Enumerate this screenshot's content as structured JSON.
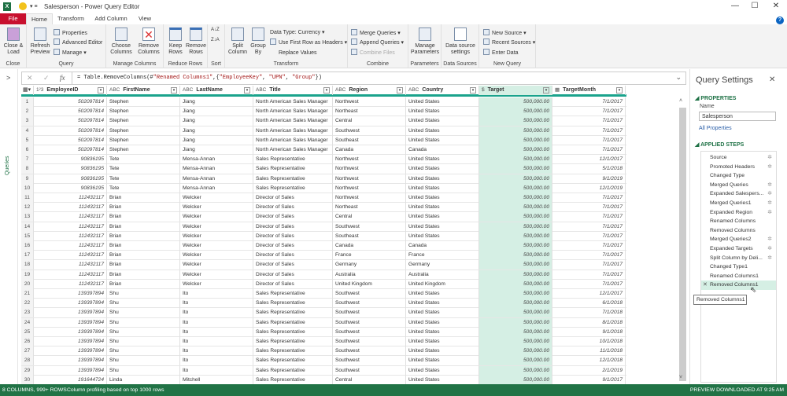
{
  "window": {
    "title": "Salesperson - Power Query Editor",
    "app_badge": "X",
    "minimize": "—",
    "maximize": "☐",
    "close": "✕",
    "help": "?"
  },
  "tabs": [
    "File",
    "Home",
    "Transform",
    "Add Column",
    "View"
  ],
  "ribbon": {
    "close": {
      "label": "Close & Load",
      "group": "Close"
    },
    "query": {
      "refresh": "Refresh Preview",
      "properties": "Properties",
      "advanced_editor": "Advanced Editor",
      "manage": "Manage",
      "group": "Query"
    },
    "manage_columns": {
      "choose": "Choose Columns",
      "remove": "Remove Columns",
      "group": "Manage Columns"
    },
    "reduce_rows": {
      "keep": "Keep Rows",
      "remove": "Remove Rows",
      "group": "Reduce Rows"
    },
    "sort": {
      "asc": "A↓Z",
      "desc": "Z↓A",
      "group": "Sort"
    },
    "transform": {
      "split": "Split Column",
      "group_by": "Group By",
      "data_type": "Data Type: Currency",
      "first_row": "Use First Row as Headers",
      "replace": "Replace Values",
      "group": "Transform"
    },
    "combine": {
      "merge": "Merge Queries",
      "append": "Append Queries",
      "combine_files": "Combine Files",
      "group": "Combine"
    },
    "parameters": {
      "manage": "Manage Parameters",
      "group": "Parameters"
    },
    "data_sources": {
      "settings": "Data source settings",
      "group": "Data Sources"
    },
    "new_query": {
      "new_source": "New Source",
      "recent": "Recent Sources",
      "enter_data": "Enter Data",
      "group": "New Query"
    }
  },
  "left_nav": {
    "label": "Queries",
    "expand": ">"
  },
  "formula_bar": {
    "cancel": "✕",
    "commit": "✓",
    "fx": "fx",
    "formula_prefix": "= Table.RemoveColumns(#",
    "formula_s1": "\"Renamed Columns1\"",
    "formula_mid1": ",{",
    "formula_s2": "\"EmployeeKey\"",
    "formula_sep1": ", ",
    "formula_s3": "\"UPN\"",
    "formula_sep2": ", ",
    "formula_s4": "\"Group\"",
    "formula_end": "})",
    "expand": "⌄"
  },
  "columns": [
    {
      "name": "EmployeeID",
      "type": "1²3"
    },
    {
      "name": "FirstName",
      "type": "ABC"
    },
    {
      "name": "LastName",
      "type": "ABC"
    },
    {
      "name": "Title",
      "type": "ABC"
    },
    {
      "name": "Region",
      "type": "ABC"
    },
    {
      "name": "Country",
      "type": "ABC"
    },
    {
      "name": "Target",
      "type": "$"
    },
    {
      "name": "TargetMonth",
      "type": "▦"
    }
  ],
  "rows": [
    [
      "502097814",
      "Stephen",
      "Jiang",
      "North American Sales Manager",
      "Northwest",
      "United States",
      "500,000.00",
      "7/1/2017"
    ],
    [
      "502097814",
      "Stephen",
      "Jiang",
      "North American Sales Manager",
      "Northeast",
      "United States",
      "500,000.00",
      "7/1/2017"
    ],
    [
      "502097814",
      "Stephen",
      "Jiang",
      "North American Sales Manager",
      "Central",
      "United States",
      "500,000.00",
      "7/1/2017"
    ],
    [
      "502097814",
      "Stephen",
      "Jiang",
      "North American Sales Manager",
      "Southwest",
      "United States",
      "500,000.00",
      "7/1/2017"
    ],
    [
      "502097814",
      "Stephen",
      "Jiang",
      "North American Sales Manager",
      "Southeast",
      "United States",
      "500,000.00",
      "7/1/2017"
    ],
    [
      "502097814",
      "Stephen",
      "Jiang",
      "North American Sales Manager",
      "Canada",
      "Canada",
      "500,000.00",
      "7/1/2017"
    ],
    [
      "90836195",
      "Tete",
      "Mensa-Annan",
      "Sales Representative",
      "Northwest",
      "United States",
      "500,000.00",
      "12/1/2017"
    ],
    [
      "90836195",
      "Tete",
      "Mensa-Annan",
      "Sales Representative",
      "Northwest",
      "United States",
      "500,000.00",
      "5/1/2018"
    ],
    [
      "90836195",
      "Tete",
      "Mensa-Annan",
      "Sales Representative",
      "Northwest",
      "United States",
      "500,000.00",
      "9/1/2019"
    ],
    [
      "90836195",
      "Tete",
      "Mensa-Annan",
      "Sales Representative",
      "Northwest",
      "United States",
      "500,000.00",
      "12/1/2019"
    ],
    [
      "112432117",
      "Brian",
      "Welcker",
      "Director of Sales",
      "Northwest",
      "United States",
      "500,000.00",
      "7/1/2017"
    ],
    [
      "112432117",
      "Brian",
      "Welcker",
      "Director of Sales",
      "Northeast",
      "United States",
      "500,000.00",
      "7/1/2017"
    ],
    [
      "112432117",
      "Brian",
      "Welcker",
      "Director of Sales",
      "Central",
      "United States",
      "500,000.00",
      "7/1/2017"
    ],
    [
      "112432117",
      "Brian",
      "Welcker",
      "Director of Sales",
      "Southwest",
      "United States",
      "500,000.00",
      "7/1/2017"
    ],
    [
      "112432117",
      "Brian",
      "Welcker",
      "Director of Sales",
      "Southeast",
      "United States",
      "500,000.00",
      "7/1/2017"
    ],
    [
      "112432117",
      "Brian",
      "Welcker",
      "Director of Sales",
      "Canada",
      "Canada",
      "500,000.00",
      "7/1/2017"
    ],
    [
      "112432117",
      "Brian",
      "Welcker",
      "Director of Sales",
      "France",
      "France",
      "500,000.00",
      "7/1/2017"
    ],
    [
      "112432117",
      "Brian",
      "Welcker",
      "Director of Sales",
      "Germany",
      "Germany",
      "500,000.00",
      "7/1/2017"
    ],
    [
      "112432117",
      "Brian",
      "Welcker",
      "Director of Sales",
      "Australia",
      "Australia",
      "500,000.00",
      "7/1/2017"
    ],
    [
      "112432117",
      "Brian",
      "Welcker",
      "Director of Sales",
      "United Kingdom",
      "United Kingdom",
      "500,000.00",
      "7/1/2017"
    ],
    [
      "139397894",
      "Shu",
      "Ito",
      "Sales Representative",
      "Southwest",
      "United States",
      "500,000.00",
      "12/1/2017"
    ],
    [
      "139397894",
      "Shu",
      "Ito",
      "Sales Representative",
      "Southwest",
      "United States",
      "500,000.00",
      "6/1/2018"
    ],
    [
      "139397894",
      "Shu",
      "Ito",
      "Sales Representative",
      "Southwest",
      "United States",
      "500,000.00",
      "7/1/2018"
    ],
    [
      "139397894",
      "Shu",
      "Ito",
      "Sales Representative",
      "Southwest",
      "United States",
      "500,000.00",
      "8/1/2018"
    ],
    [
      "139397894",
      "Shu",
      "Ito",
      "Sales Representative",
      "Southwest",
      "United States",
      "500,000.00",
      "9/1/2018"
    ],
    [
      "139397894",
      "Shu",
      "Ito",
      "Sales Representative",
      "Southwest",
      "United States",
      "500,000.00",
      "10/1/2018"
    ],
    [
      "139397894",
      "Shu",
      "Ito",
      "Sales Representative",
      "Southwest",
      "United States",
      "500,000.00",
      "11/1/2018"
    ],
    [
      "139397894",
      "Shu",
      "Ito",
      "Sales Representative",
      "Southwest",
      "United States",
      "500,000.00",
      "12/1/2018"
    ],
    [
      "139397894",
      "Shu",
      "Ito",
      "Sales Representative",
      "Southwest",
      "United States",
      "500,000.00",
      "2/1/2019"
    ],
    [
      "191644724",
      "Linda",
      "Mitchell",
      "Sales Representative",
      "Central",
      "United States",
      "500,000.00",
      "9/1/2017"
    ]
  ],
  "query_settings": {
    "title": "Query Settings",
    "close": "✕",
    "properties_heading": "◢ PROPERTIES",
    "name_label": "Name",
    "name_value": "Salesperson",
    "all_properties": "All Properties",
    "steps_heading": "◢ APPLIED STEPS",
    "steps": [
      {
        "label": "Source",
        "gear": true
      },
      {
        "label": "Promoted Headers",
        "gear": true
      },
      {
        "label": "Changed Type",
        "gear": false
      },
      {
        "label": "Merged Queries",
        "gear": true
      },
      {
        "label": "Expanded Salespers...",
        "gear": true
      },
      {
        "label": "Merged Queries1",
        "gear": true
      },
      {
        "label": "Expanded Region",
        "gear": true
      },
      {
        "label": "Renamed Columns",
        "gear": false
      },
      {
        "label": "Removed Columns",
        "gear": false
      },
      {
        "label": "Merged Queries2",
        "gear": true
      },
      {
        "label": "Expanded Targets",
        "gear": true
      },
      {
        "label": "Split Column by Deli...",
        "gear": true
      },
      {
        "label": "Changed Type1",
        "gear": false
      },
      {
        "label": "Renamed Columns1",
        "gear": false
      },
      {
        "label": "Removed Columns1",
        "gear": false,
        "selected": true
      }
    ],
    "tooltip": "Removed Columns1"
  },
  "status": {
    "left": "8 COLUMNS, 999+ ROWS",
    "profiling": "Column profiling based on top 1000 rows",
    "right": "PREVIEW DOWNLOADED AT 9:25 AM"
  },
  "colors": {
    "accent": "#217346",
    "file_tab": "#c8102e",
    "selected_col": "#d5efe4",
    "header_line": "#1aa38c"
  }
}
